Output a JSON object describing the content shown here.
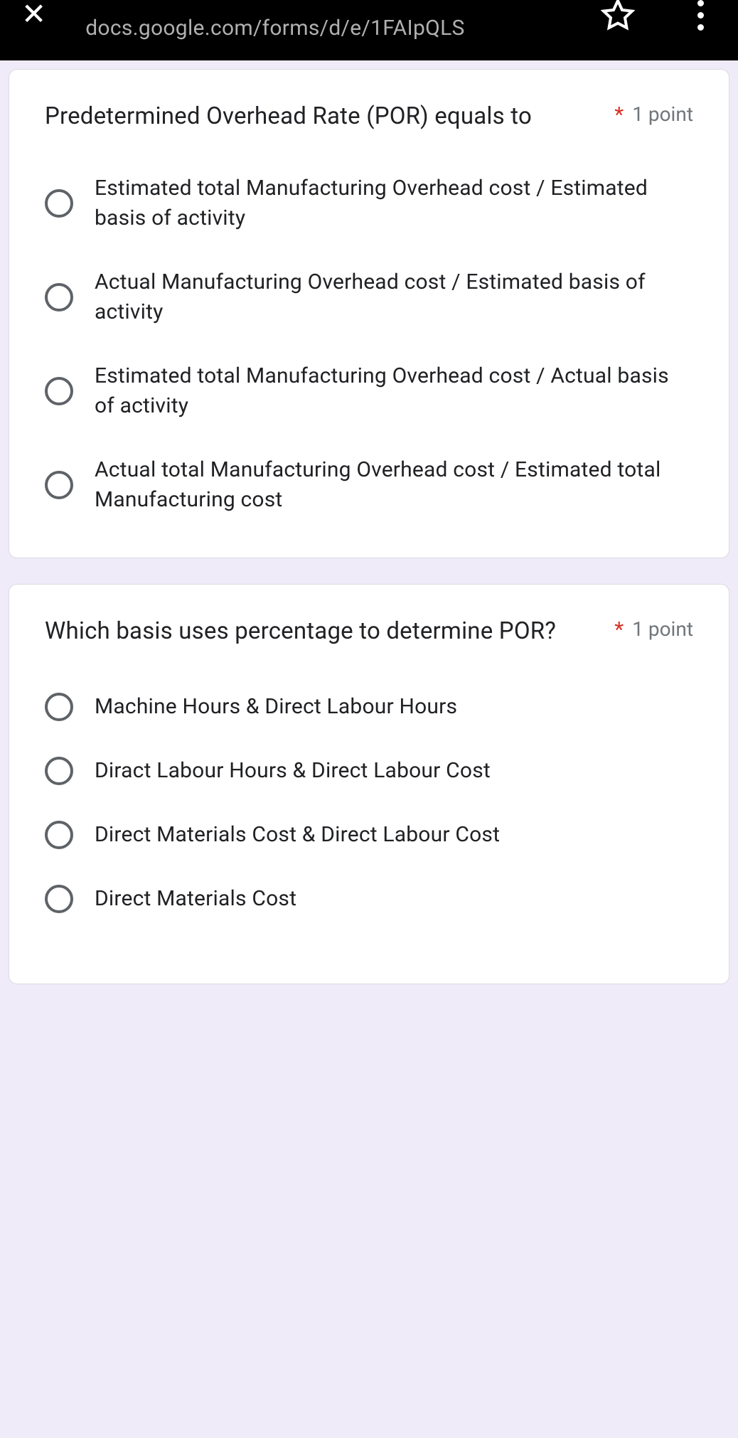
{
  "browser": {
    "url": "docs.google.com/forms/d/e/1FAIpQLS"
  },
  "questions": [
    {
      "title": "Predetermined Overhead Rate (POR) equals to",
      "required_mark": "*",
      "points": "1 point",
      "options": [
        "Estimated total Manufacturing Overhead cost / Estimated basis of activity",
        "Actual Manufacturing Overhead cost / Estimated basis of activity",
        "Estimated total Manufacturing Overhead cost / Actual basis of activity",
        "Actual total Manufacturing Overhead cost / Estimated total Manufacturing cost"
      ]
    },
    {
      "title": "Which basis uses percentage to determine POR?",
      "required_mark": "*",
      "points": "1 point",
      "options": [
        "Machine Hours & Direct Labour Hours",
        "Diract Labour Hours & Direct Labour Cost",
        "Direct Materials Cost & Direct Labour Cost",
        "Direct Materials Cost"
      ]
    }
  ]
}
